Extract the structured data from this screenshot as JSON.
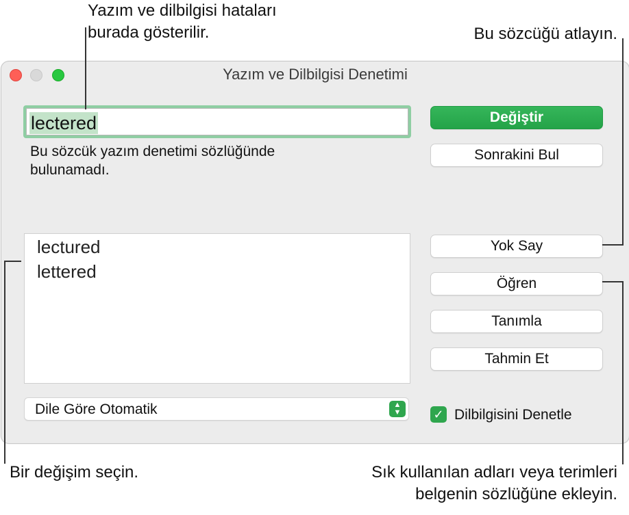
{
  "callouts": {
    "errors": [
      "Yazım ve dilbilgisi hataları",
      "burada gösterilir."
    ],
    "ignore": "Bu sözcüğü atlayın.",
    "choose": "Bir değişim seçin.",
    "learn": [
      "Sık kullanılan adları veya terimleri",
      "belgenin sözlüğüne ekleyin."
    ]
  },
  "window": {
    "title": "Yazım ve Dilbilgisi Denetimi",
    "misspelled_word": "lectered",
    "message": "Bu sözcük yazım denetimi sözlüğünde bulunamadı.",
    "suggestions": [
      "lectured",
      "lettered"
    ],
    "language": "Dile Göre Otomatik",
    "buttons": {
      "change": "Değiştir",
      "find_next": "Sonrakini Bul",
      "ignore": "Yok Say",
      "learn": "Öğren",
      "define": "Tanımla",
      "guess": "Tahmin Et"
    },
    "grammar_check": {
      "label": "Dilbilgisini Denetle",
      "checked": true
    },
    "accent_color": "#2fa64e"
  }
}
